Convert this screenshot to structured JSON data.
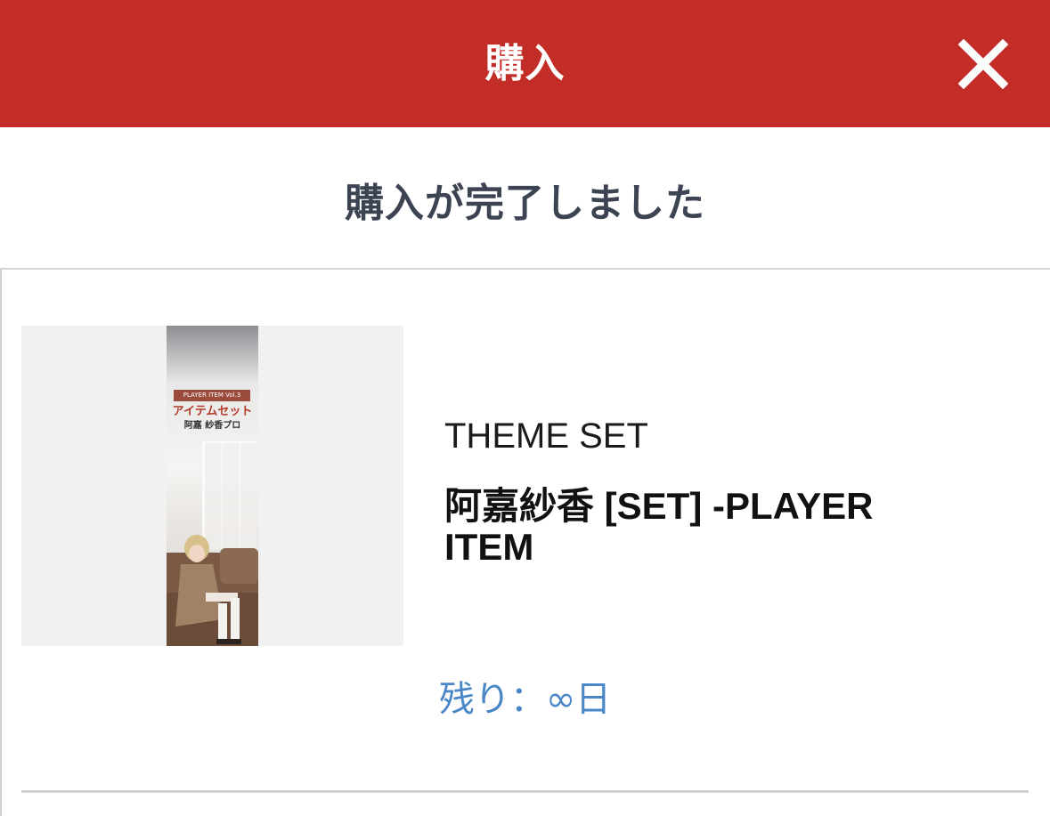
{
  "header": {
    "title": "購入",
    "close_icon": "close-icon",
    "background_color": "#c22e27"
  },
  "status": {
    "message": "購入が完了しました"
  },
  "product": {
    "image": {
      "tag": "PLAYER ITEM Vol.3",
      "title": "アイテムセット",
      "subtitle": "阿嘉 紗香プロ"
    },
    "type": "THEME SET",
    "name": "阿嘉紗香 [SET] -PLAYER ITEM",
    "remaining": "残り：∞日",
    "remaining_color": "#4a87c6"
  }
}
